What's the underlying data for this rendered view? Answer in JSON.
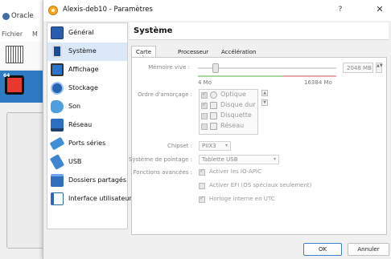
{
  "background_app": {
    "title": "Oracle",
    "menu": [
      "Fichier",
      "M"
    ],
    "vm_badge": "64"
  },
  "dialog": {
    "title": "Alexis-deb10 - Paramètres",
    "help": "?",
    "close": "✕"
  },
  "sidebar": {
    "items": [
      {
        "label": "Général",
        "icon": "general-icon",
        "color": "#2a5db0"
      },
      {
        "label": "Système",
        "icon": "system-icon",
        "color": "#3a7ad0"
      },
      {
        "label": "Affichage",
        "icon": "display-icon",
        "color": "#2a74c9"
      },
      {
        "label": "Stockage",
        "icon": "storage-icon",
        "color": "#2563b3"
      },
      {
        "label": "Son",
        "icon": "sound-icon",
        "color": "#4d9fe0"
      },
      {
        "label": "Réseau",
        "icon": "network-icon",
        "color": "#2b6fc2"
      },
      {
        "label": "Ports séries",
        "icon": "serial-ports-icon",
        "color": "#3f8fd8"
      },
      {
        "label": "USB",
        "icon": "usb-icon",
        "color": "#3d86cf"
      },
      {
        "label": "Dossiers partagés",
        "icon": "shared-folders-icon",
        "color": "#2f6fbd"
      },
      {
        "label": "Interface utilisateur",
        "icon": "user-interface-icon",
        "color": "#2d68b8"
      }
    ],
    "selected_index": 1
  },
  "content": {
    "section_title": "Système",
    "tabs": [
      "Carte mère",
      "Processeur",
      "Accélération"
    ],
    "active_tab": 0,
    "memory": {
      "label": "Mémoire vive :",
      "min_label": "4 Mo",
      "max_label": "16384 Mo",
      "value": "2048 MB",
      "fraction": 0.125,
      "spin": "▲▼"
    },
    "boot_order": {
      "label": "Ordre d'amorçage :",
      "items": [
        {
          "label": "Optique",
          "checked": true,
          "icon": "optical-disc-icon"
        },
        {
          "label": "Disque dur",
          "checked": true,
          "icon": "hard-disk-icon"
        },
        {
          "label": "Disquette",
          "checked": false,
          "icon": "floppy-icon"
        },
        {
          "label": "Réseau",
          "checked": false,
          "icon": "network-boot-icon"
        }
      ],
      "up": "▲",
      "down": "▼"
    },
    "chipset": {
      "label": "Chipset :",
      "value": "PIIX3"
    },
    "pointing": {
      "label": "Système de pointage :",
      "value": "Tablette USB"
    },
    "advanced": {
      "label": "Fonctions avancées :",
      "options": [
        {
          "label": "Activer les IO-APIC",
          "checked": true
        },
        {
          "label": "Activer EFI (OS spéciaux seulement)",
          "checked": false
        },
        {
          "label": "Horloge interne en UTC",
          "checked": true
        }
      ]
    }
  },
  "footer": {
    "ok": "OK",
    "cancel": "Annuler"
  }
}
